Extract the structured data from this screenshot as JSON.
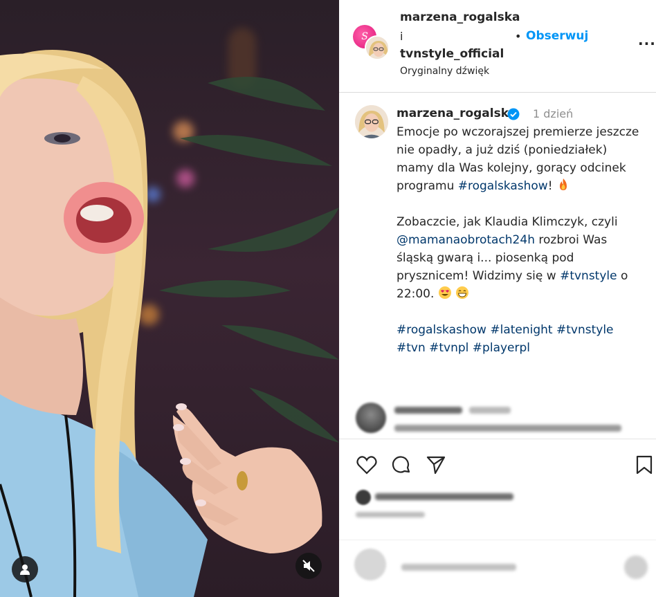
{
  "header": {
    "user1": "marzena_rogalska",
    "and_text": "i",
    "user2": "tvnstyle_official",
    "audio": "Oryginalny dźwięk",
    "dot": "•",
    "follow_label": "Obserwuj",
    "more_label": "...",
    "avatar_a_letter": "S"
  },
  "caption": {
    "username": "marzena_rogalska",
    "time": "1 dzień",
    "p1_text": "Emocje po wczorajszej premierze jeszcze nie opadły, a już dziś (poniedziałek) mamy dla Was kolejny, gorący odcinek programu ",
    "p1_tag": "#rogalskashow",
    "p1_end": "!",
    "p2_a": "Zobaczcie, jak Klaudia Klimczyk, czyli ",
    "p2_mention": "@mamanaobrotach24h",
    "p2_b": " rozbroi Was śląską gwarą i... piosenką pod prysznicem! Widzimy się w ",
    "p2_tag": "#tvnstyle",
    "p2_c": " o 22:00.",
    "hashtags_line1": "#rogalskashow #latenight #tvnstyle",
    "hashtags_line2": "#tvn #tvnpl #playerpl"
  },
  "icons": {
    "verified": "verified-badge-icon",
    "fire": "fire-emoji",
    "heart_eyes": "heart-eyes-emoji",
    "grin": "grinning-emoji",
    "like": "heart-icon",
    "comment": "comment-icon",
    "share": "share-icon",
    "save": "bookmark-icon",
    "user": "user-icon",
    "mute": "muted-speaker-icon"
  },
  "colors": {
    "link": "#0095f6",
    "hashtag": "#00376b",
    "muted_text": "#8e8e8e",
    "verified": "#0095f6"
  }
}
